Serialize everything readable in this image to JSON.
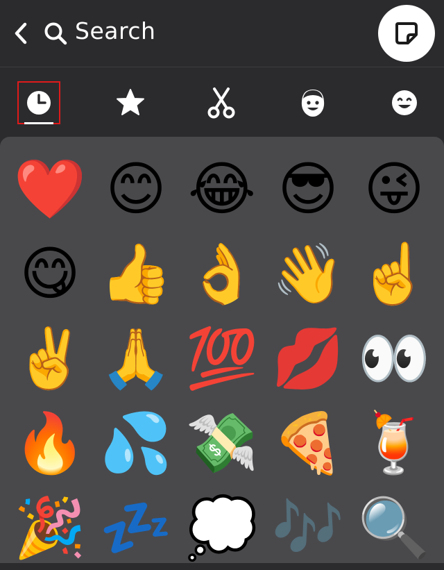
{
  "header": {
    "search_label": "Search"
  },
  "icons": {
    "back": "chevron-left-icon",
    "search": "search-icon",
    "sticker": "sticker-icon"
  },
  "tabs": [
    {
      "name": "recent",
      "icon": "clock-icon",
      "selected": true
    },
    {
      "name": "favorites",
      "icon": "star-icon",
      "selected": false
    },
    {
      "name": "cutouts",
      "icon": "scissors-icon",
      "selected": false
    },
    {
      "name": "bitmoji",
      "icon": "bitmoji-face-icon",
      "selected": false
    },
    {
      "name": "emoji",
      "icon": "smiley-icon",
      "selected": false
    }
  ],
  "colors": {
    "background": "#2b2b2e",
    "panel": "#49494c",
    "selection": "#e01a1a"
  },
  "emojis": [
    {
      "char": "❤️",
      "name": "red-heart-emoji"
    },
    {
      "char": "😊",
      "name": "smiling-face-emoji"
    },
    {
      "char": "😂",
      "name": "tears-of-joy-emoji"
    },
    {
      "char": "😎",
      "name": "sunglasses-face-emoji"
    },
    {
      "char": "😜",
      "name": "winking-tongue-emoji"
    },
    {
      "char": "😋",
      "name": "savoring-food-emoji"
    },
    {
      "char": "👍",
      "name": "thumbs-up-emoji"
    },
    {
      "char": "👌",
      "name": "ok-hand-emoji"
    },
    {
      "char": "👋",
      "name": "waving-hand-emoji"
    },
    {
      "char": "☝️",
      "name": "index-pointing-up-emoji"
    },
    {
      "char": "✌️",
      "name": "victory-hand-emoji"
    },
    {
      "char": "🙏",
      "name": "folded-hands-emoji"
    },
    {
      "char": "💯",
      "name": "hundred-points-emoji"
    },
    {
      "char": "💋",
      "name": "kiss-mark-emoji"
    },
    {
      "char": "👀",
      "name": "eyes-emoji"
    },
    {
      "char": "🔥",
      "name": "fire-emoji"
    },
    {
      "char": "💦",
      "name": "sweat-droplets-emoji"
    },
    {
      "char": "💸",
      "name": "money-with-wings-emoji"
    },
    {
      "char": "🍕",
      "name": "pizza-emoji"
    },
    {
      "char": "🍹",
      "name": "tropical-drink-emoji"
    },
    {
      "char": "🎉",
      "name": "party-popper-emoji"
    },
    {
      "char": "💤",
      "name": "zzz-emoji"
    },
    {
      "char": "💭",
      "name": "thought-balloon-emoji"
    },
    {
      "char": "🎶",
      "name": "musical-notes-emoji"
    },
    {
      "char": "🔍",
      "name": "magnifying-glass-emoji"
    }
  ]
}
